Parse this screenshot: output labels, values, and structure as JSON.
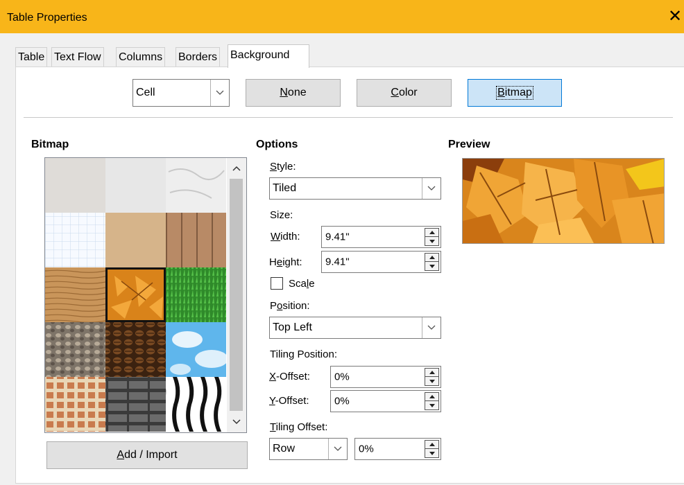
{
  "window": {
    "title": "Table Properties",
    "close_glyph": "✕"
  },
  "tabs": [
    {
      "label": "Table"
    },
    {
      "label": "Text Flow"
    },
    {
      "label": "Columns"
    },
    {
      "label": "Borders"
    },
    {
      "label": "Background",
      "active": true
    }
  ],
  "area": {
    "target": "Cell",
    "buttons": {
      "none": "None",
      "color": "Color",
      "bitmap": "Bitmap"
    },
    "selected": "Bitmap"
  },
  "bitmap": {
    "header": "Bitmap",
    "add_import": "Add / Import",
    "tiles": [
      "painted-white",
      "paper-texture",
      "paper-crumpled",
      "paper-graph",
      "parchment-paper",
      "fence",
      "wooden-board",
      "maple-leaves",
      "lawn",
      "stone",
      "coffee-beans",
      "clouds",
      "mosaic",
      "stone-wall",
      "zebra"
    ],
    "selected_index": 7
  },
  "options": {
    "header": "Options",
    "style_label": "Style:",
    "style_value": "Tiled",
    "size_label": "Size:",
    "width_label": "Width:",
    "width_value": "9.41\"",
    "height_label": "Height:",
    "height_value": "9.41\"",
    "scale_label": "Scale",
    "scale_checked": false,
    "position_label": "Position:",
    "position_value": "Top Left",
    "tiling_position_label": "Tiling Position:",
    "x_offset_label": "X-Offset:",
    "x_offset_value": "0%",
    "y_offset_label": "Y-Offset:",
    "y_offset_value": "0%",
    "tiling_offset_label": "Tiling Offset:",
    "tiling_offset_mode": "Row",
    "tiling_offset_value": "0%"
  },
  "preview": {
    "header": "Preview"
  },
  "colors": {
    "titlebar": "#f8b519",
    "selected_button": "#cce4f7",
    "accent": "#0078d7"
  }
}
